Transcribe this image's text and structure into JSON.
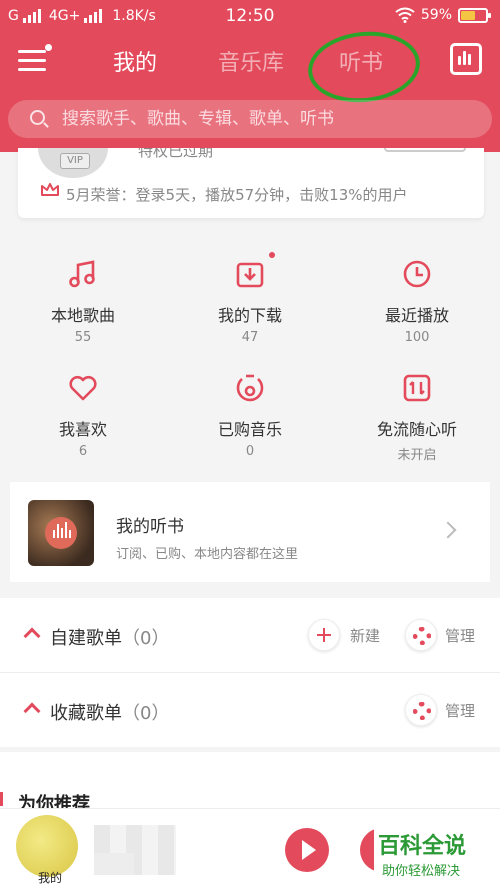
{
  "status_bar": {
    "carrier": "G",
    "network": "4G+",
    "speed": "1.8K/s",
    "time": "12:50",
    "battery": "59%",
    "battery_level": 0.59
  },
  "header": {
    "tabs": [
      {
        "label": "我的",
        "active": true
      },
      {
        "label": "音乐库",
        "active": false
      },
      {
        "label": "听书",
        "active": false
      }
    ],
    "accent_color": "#e34b5c"
  },
  "search": {
    "placeholder": "搜索歌手、歌曲、专辑、歌单、听书"
  },
  "profile": {
    "vip_badge": "VIP",
    "expired_text": "特权已过期",
    "honor_text": "5月荣誉：登录5天，播放57分钟，击败13%的用户"
  },
  "grid": [
    {
      "label": "本地歌曲",
      "sub": "55",
      "icon": "music-note-icon"
    },
    {
      "label": "我的下载",
      "sub": "47",
      "icon": "download-icon"
    },
    {
      "label": "最近播放",
      "sub": "100",
      "icon": "clock-icon"
    },
    {
      "label": "我喜欢",
      "sub": "6",
      "icon": "heart-icon"
    },
    {
      "label": "已购音乐",
      "sub": "0",
      "icon": "purchased-disc-icon"
    },
    {
      "label": "免流随心听",
      "sub": "未开启",
      "icon": "data-free-icon"
    }
  ],
  "audiobook": {
    "title": "我的听书",
    "subtitle": "订阅、已购、本地内容都在这里"
  },
  "sections": [
    {
      "title": "自建歌单",
      "count": "（0）",
      "new_label": "新建",
      "manage_label": "管理"
    },
    {
      "title": "收藏歌单",
      "count": "（0）",
      "manage_label": "管理"
    }
  ],
  "recommend": {
    "title": "为你推荐"
  },
  "player": {
    "art_label": "我的"
  },
  "watermark": {
    "title": "百科全说",
    "subtitle": "助你轻松解决"
  }
}
